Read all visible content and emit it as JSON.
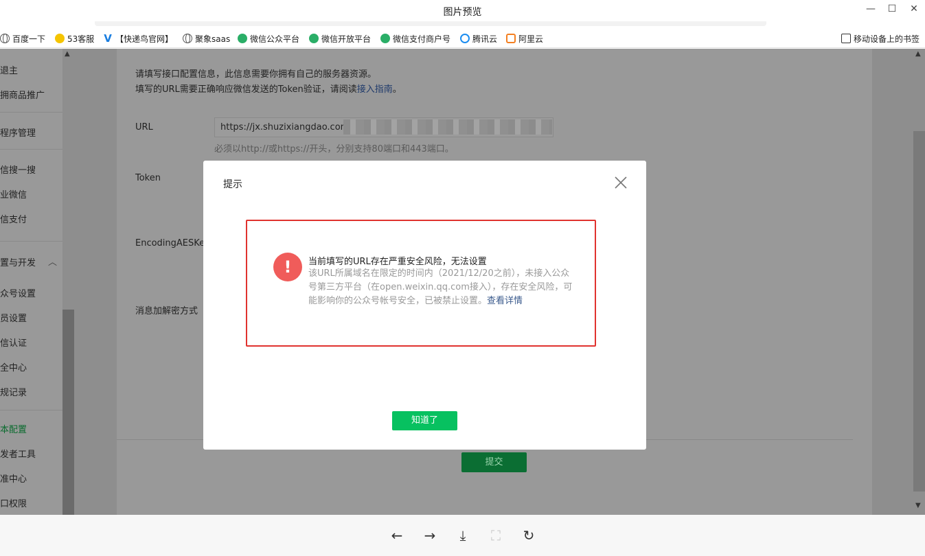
{
  "window": {
    "title": "图片预览",
    "min_label": "—",
    "max_label": "☐",
    "close_label": "✕"
  },
  "bookmarks": [
    {
      "label": "百度一下",
      "icon": "globe-icon"
    },
    {
      "label": "53客服",
      "icon": "53-icon"
    },
    {
      "label": "【快递鸟官网】",
      "icon": "v-icon"
    },
    {
      "label": "聚象saas",
      "icon": "globe-icon"
    },
    {
      "label": "微信公众平台",
      "icon": "wechat-icon"
    },
    {
      "label": "微信开放平台",
      "icon": "wechat-icon"
    },
    {
      "label": "微信支付商户号",
      "icon": "wechat-pay-icon"
    },
    {
      "label": "腾讯云",
      "icon": "cloud-icon"
    },
    {
      "label": "阿里云",
      "icon": "aliyun-icon"
    }
  ],
  "bookmark_mobile": "移动设备上的书签",
  "sidebar": {
    "items": [
      "退主",
      "拥商品推广",
      "程序管理",
      "信搜一搜",
      "业微信",
      "信支付",
      "置与开发",
      "众号设置",
      "员设置",
      "信认证",
      "全中心",
      "规记录",
      "本配置",
      "发者工具",
      "准中心",
      "口权限"
    ],
    "active_index": 12
  },
  "config": {
    "intro_line1": "请填写接口配置信息，此信息需要你拥有自己的服务器资源。",
    "intro_line2_prefix": "填写的URL需要正确响应微信发送的Token验证，请阅读",
    "intro_link": "接入指南",
    "intro_line2_suffix": "。",
    "url_label": "URL",
    "url_value": "https://jx.shuzixiangdao.com/",
    "url_hint": "必须以http://或https://开头，分别支持80端口和443端口。",
    "token_label": "Token",
    "aeskey_label": "EncodingAESKey",
    "encrypt_label": "消息加解密方式",
    "submit_label": "提交"
  },
  "dialog": {
    "title": "提示",
    "warning_title": "当前填写的URL存在严重安全风险，无法设置",
    "warning_body": "该URL所属域名在限定的时间内（2021/12/20之前），未接入公众号第三方平台（在open.weixin.qq.com接入），存在安全风险，可能影响你的公众号帐号安全，已被禁止设置。",
    "detail_link": "查看详情",
    "ok_label": "知道了"
  },
  "toolbar": {
    "prev": "←",
    "next": "→",
    "download": "⤓",
    "fit": "⛶",
    "rotate": "↻"
  }
}
